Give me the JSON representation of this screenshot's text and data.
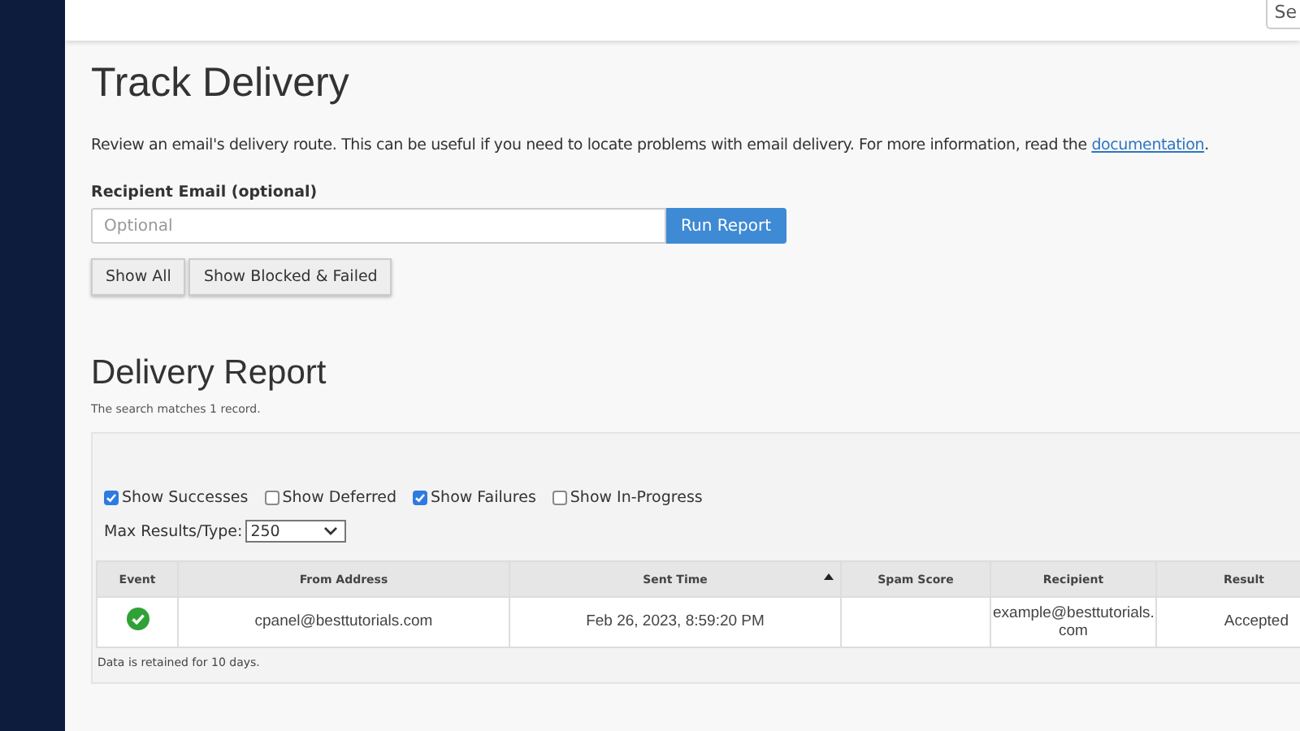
{
  "top_bar": {
    "search": {
      "value": "Se"
    }
  },
  "title": "Track Delivery",
  "intro": {
    "text": "Review an email's delivery route. This can be useful if you need to locate problems with email delivery. For more information, read the ",
    "link": "documentation",
    "after": "."
  },
  "recipient_field": {
    "label": "Recipient Email (optional)",
    "placeholder": "Optional",
    "button": "Run Report"
  },
  "view_buttons": [
    "Show All",
    "Show Blocked & Failed"
  ],
  "report": {
    "title": "Delivery Report",
    "summary": "The search matches 1 record.",
    "filters": [
      {
        "label": "Show Successes",
        "checked": true
      },
      {
        "label": "Show Deferred",
        "checked": false
      },
      {
        "label": "Show Failures",
        "checked": true
      },
      {
        "label": "Show In-Progress",
        "checked": false
      }
    ],
    "max_results": {
      "label": "Max Results/Type:",
      "value": "250"
    },
    "table": {
      "columns": [
        {
          "label": "Event",
          "sorted": false
        },
        {
          "label": "From Address",
          "sorted": false
        },
        {
          "label": "Sent Time",
          "sorted": true
        },
        {
          "label": "Spam Score",
          "sorted": false
        },
        {
          "label": "Recipient",
          "sorted": false
        },
        {
          "label": "Result",
          "sorted": false
        }
      ],
      "rows": [
        {
          "delivered": true,
          "from": "cpanel@besttutorials.com",
          "sent": "Feb 26, 2023, 8:59:20 PM",
          "recipient": "example@besttutorials.\ncom",
          "result": "Accepted"
        }
      ]
    },
    "footnote": "Data is retained for 10 days."
  }
}
